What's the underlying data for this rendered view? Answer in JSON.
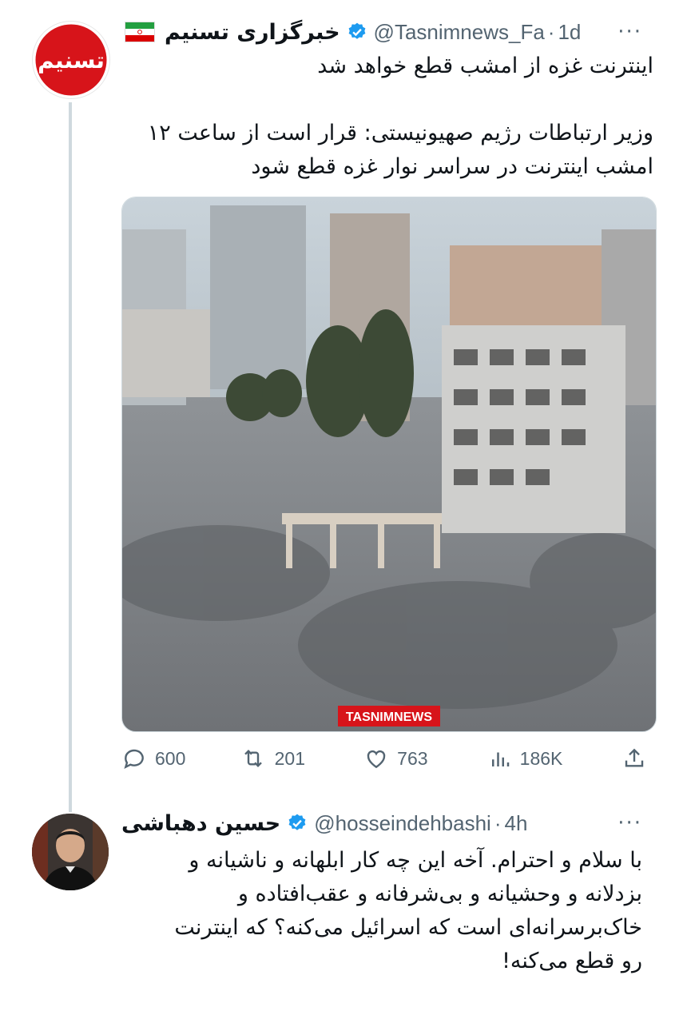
{
  "tweet1": {
    "display_name": "خبرگزاری تسنیم",
    "handle": "@Tasnimnews_Fa",
    "separator": "·",
    "time": "1d",
    "more": "···",
    "line1": "اینترنت غزه از امشب قطع خواهد شد",
    "body": "وزیر ارتباطات رژیم صهیونیستی: قرار است از ساعت ۱۲\nامشب اینترنت در سراسر نوار غزه قطع شود",
    "media_watermark": "TASNIMNEWS",
    "avatar_logo_text": "تسنیم",
    "stats": {
      "replies": "600",
      "retweets": "201",
      "likes": "763",
      "views": "186K"
    }
  },
  "tweet2": {
    "display_name": "حسین دهباشی",
    "handle": "@hosseindehbashi",
    "separator": "·",
    "time": "4h",
    "more": "···",
    "body": "با سلام و احترام. آخه این چه کار ابلهانه و ناشیانه و\nبزدلانه و وحشیانه و بی‌شرفانه و عقب‌افتاده و\nخاک‌برسرانه‌ای است که اسرائیل می‌کنه؟  که اینترنت\nرو قطع می‌کنه!"
  },
  "colors": {
    "text": "#0f1419",
    "muted": "#536471",
    "verified": "#1d9bf0",
    "tasnim_red": "#d7141a",
    "thread_line": "#cfd9de"
  },
  "icons": [
    "reply-icon",
    "retweet-icon",
    "like-icon",
    "views-icon",
    "share-icon",
    "verified-icon",
    "iran-flag-icon",
    "more-icon"
  ]
}
